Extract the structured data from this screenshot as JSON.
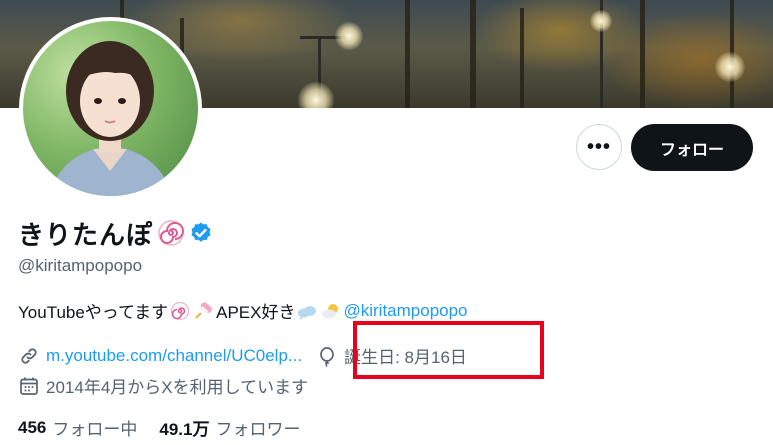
{
  "profile": {
    "display_name": "きりたんぽ",
    "handle": "@kiritampopopo",
    "bio_text_1": "YouTubeやってます",
    "bio_text_2": "APEX好き",
    "bio_mention": "@kiritampopopo",
    "website": "m.youtube.com/channel/UC0elp...",
    "birthday": "誕生日: 8月16日",
    "joined": "2014年4月からXを利用しています",
    "following_count": "456",
    "following_label": "フォロー中",
    "followers_count": "49.1万",
    "followers_label": "フォロワー"
  },
  "actions": {
    "more_label": "•••",
    "follow_label": "フォロー"
  },
  "icons": {
    "name_badge": "naruto-swirl-icon",
    "verified": "verified-badge-icon",
    "website": "link-icon",
    "birthday": "balloon-icon",
    "joined": "calendar-icon",
    "bio_emoji_1": "naruto-swirl-icon",
    "bio_emoji_2": "candy-icon",
    "bio_emoji_3": "cloud-icon",
    "bio_emoji_4": "cloud-sun-icon"
  },
  "colors": {
    "link": "#1d9bf0",
    "secondary_text": "#536471",
    "follow_button": "#0f1419",
    "highlight": "#e8001c",
    "verified": "#1d9bf0"
  }
}
